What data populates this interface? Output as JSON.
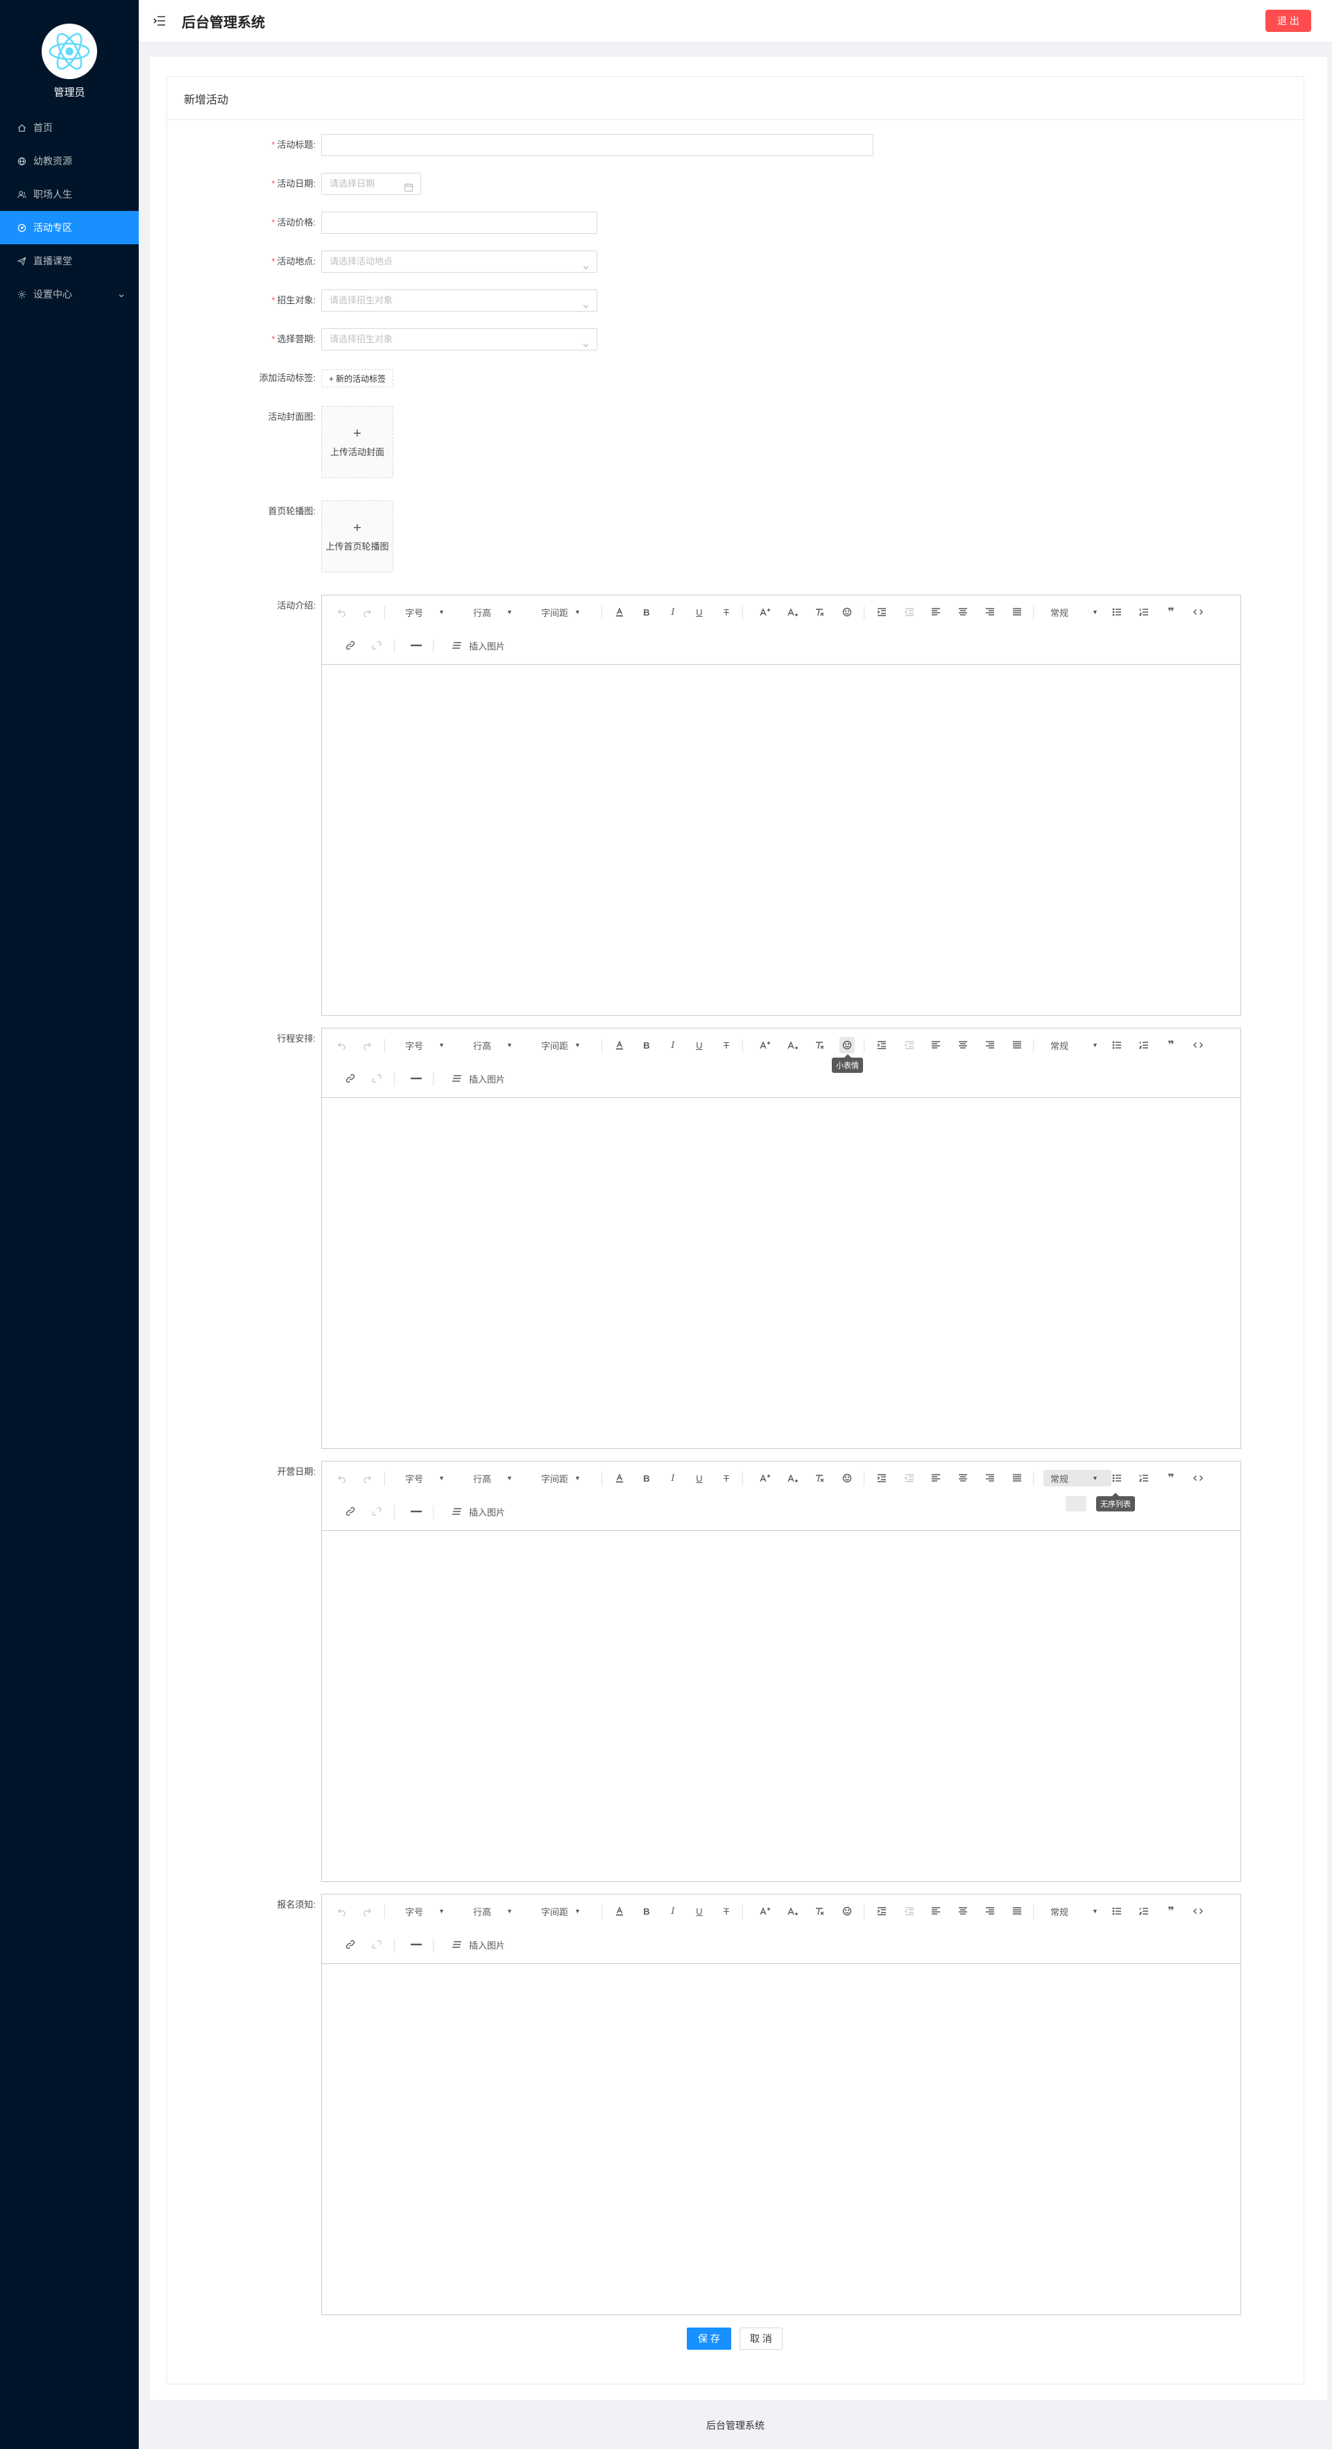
{
  "sidebar": {
    "user_name": "管理员",
    "items": [
      {
        "label": "首页",
        "icon": "home-icon"
      },
      {
        "label": "幼教资源",
        "icon": "globe-icon"
      },
      {
        "label": "职场人生",
        "icon": "users-icon"
      },
      {
        "label": "活动专区",
        "icon": "dashboard-icon",
        "active": true
      },
      {
        "label": "直播课堂",
        "icon": "send-icon"
      },
      {
        "label": "设置中心",
        "icon": "gear-icon",
        "has_children": true
      }
    ]
  },
  "header": {
    "title": "后台管理系统",
    "logout_label": "退 出"
  },
  "page": {
    "card_title": "新增活动"
  },
  "form": {
    "title": {
      "label": "活动标题:",
      "required": true,
      "value": ""
    },
    "date": {
      "label": "活动日期:",
      "required": true,
      "placeholder": "请选择日期"
    },
    "price": {
      "label": "活动价格:",
      "required": true,
      "value": ""
    },
    "location": {
      "label": "活动地点:",
      "required": true,
      "placeholder": "请选择活动地点"
    },
    "audience": {
      "label": "招生对象:",
      "required": true,
      "placeholder": "请选择招生对象"
    },
    "term": {
      "label": "选择营期:",
      "required": true,
      "placeholder": "请选择招生对象"
    },
    "tags": {
      "label": "添加活动标签:",
      "button": "+ 新的活动标签"
    },
    "cover": {
      "label": "活动封面图:",
      "upload": "上传活动封面"
    },
    "banner": {
      "label": "首页轮播图:",
      "upload": "上传首页轮播图"
    }
  },
  "editors": [
    {
      "label": "活动介绍:"
    },
    {
      "label": "行程安排:",
      "tooltip": "小表情"
    },
    {
      "label": "开营日期:",
      "tooltip": "无序列表"
    },
    {
      "label": "报名须知:"
    }
  ],
  "toolbar": {
    "font_size": "字号",
    "line_height": "行高",
    "letter_spacing": "字间距",
    "heading": "常规",
    "insert_image": "插入图片",
    "bold": "B",
    "italic": "I",
    "underline": "U",
    "strike": "T",
    "quote": "❞"
  },
  "actions": {
    "save": "保 存",
    "cancel": "取 消"
  },
  "footer": {
    "text": "后台管理系统"
  },
  "colors": {
    "sidebar_bg": "#001529",
    "active": "#1890ff",
    "danger": "#ff4d4f"
  }
}
